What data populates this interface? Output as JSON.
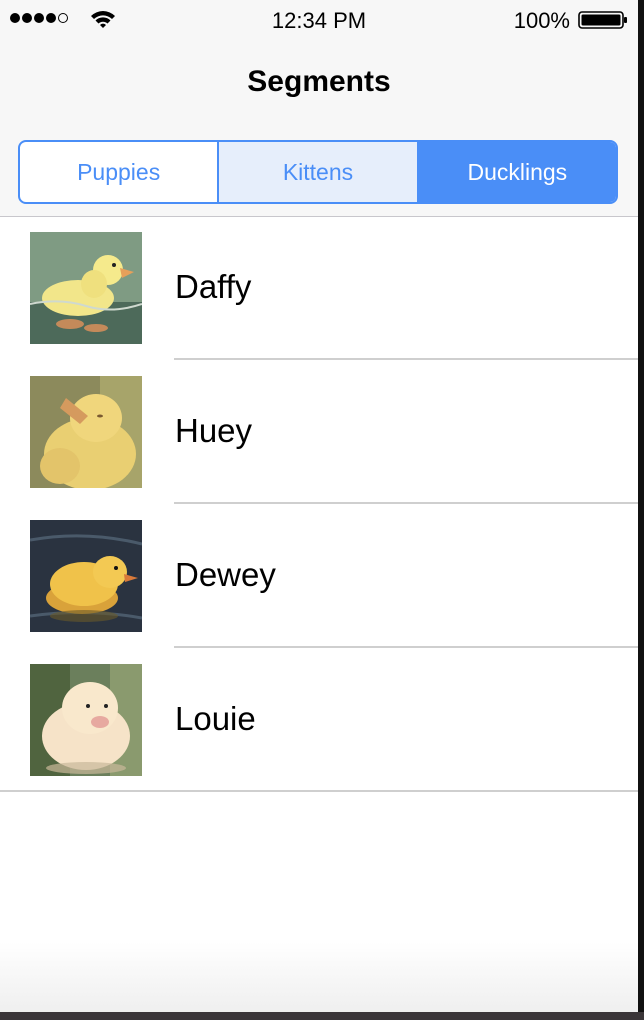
{
  "status_bar": {
    "signal_filled": 4,
    "signal_total": 5,
    "time": "12:34 PM",
    "battery_percent": "100%",
    "icons": [
      "signal-dots",
      "wifi-icon",
      "battery-icon"
    ]
  },
  "nav": {
    "title": "Segments"
  },
  "segments": {
    "items": [
      {
        "label": "Puppies",
        "state": "normal"
      },
      {
        "label": "Kittens",
        "state": "pressed"
      },
      {
        "label": "Ducklings",
        "state": "selected"
      }
    ],
    "selected_index": 2
  },
  "rows": [
    {
      "name": "Daffy",
      "thumbnail": "duckling-swimming-photo"
    },
    {
      "name": "Huey",
      "thumbnail": "duckling-head-up-photo"
    },
    {
      "name": "Dewey",
      "thumbnail": "duckling-on-water-photo"
    },
    {
      "name": "Louie",
      "thumbnail": "fluffy-duckling-photo"
    }
  ],
  "colors": {
    "accent": "#4a8ef7",
    "pressed": "#e6eefb",
    "bar_background": "#f7f7f7",
    "separator": "#cfcfcf"
  }
}
